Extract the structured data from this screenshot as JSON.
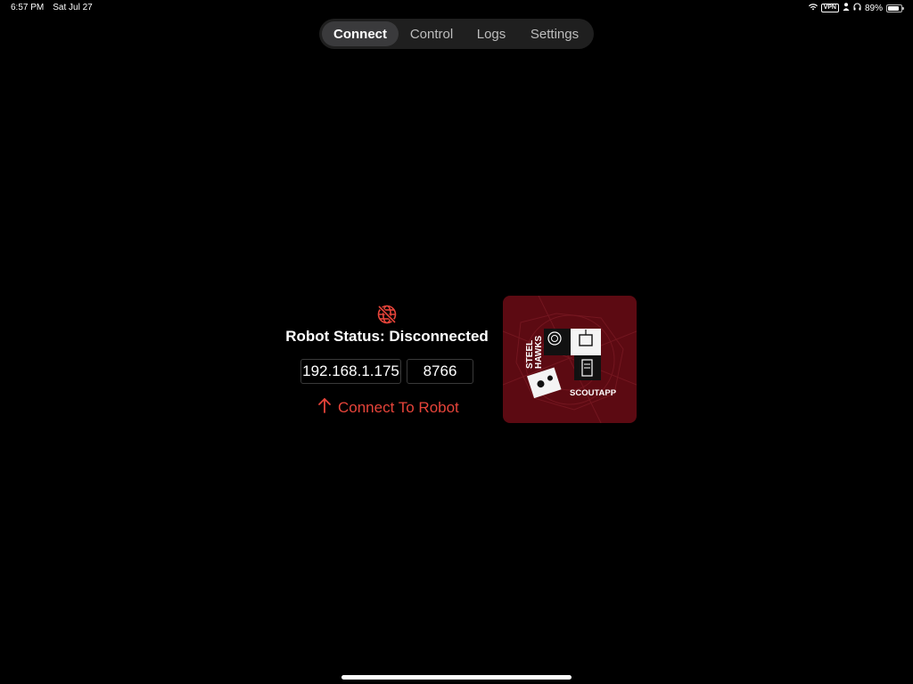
{
  "status_bar": {
    "time": "6:57 PM",
    "date": "Sat Jul 27",
    "vpn": "VPN",
    "battery_percent": "89%",
    "battery_level": 0.89
  },
  "tabs": [
    {
      "label": "Connect",
      "active": true
    },
    {
      "label": "Control",
      "active": false
    },
    {
      "label": "Logs",
      "active": false
    },
    {
      "label": "Settings",
      "active": false
    }
  ],
  "connect": {
    "status_icon": "globe-slash-icon",
    "status_text": "Robot Status: Disconnected",
    "ip_value": "192.168.1.175",
    "port_value": "8766",
    "connect_label": "Connect To Robot",
    "connect_icon": "arrow-up-icon",
    "accent_color": "#e6443a"
  },
  "logo": {
    "line1": "STEEL",
    "line2": "HAWKS",
    "app_name": "SCOUTAPP",
    "background_color": "#5c0a12"
  }
}
